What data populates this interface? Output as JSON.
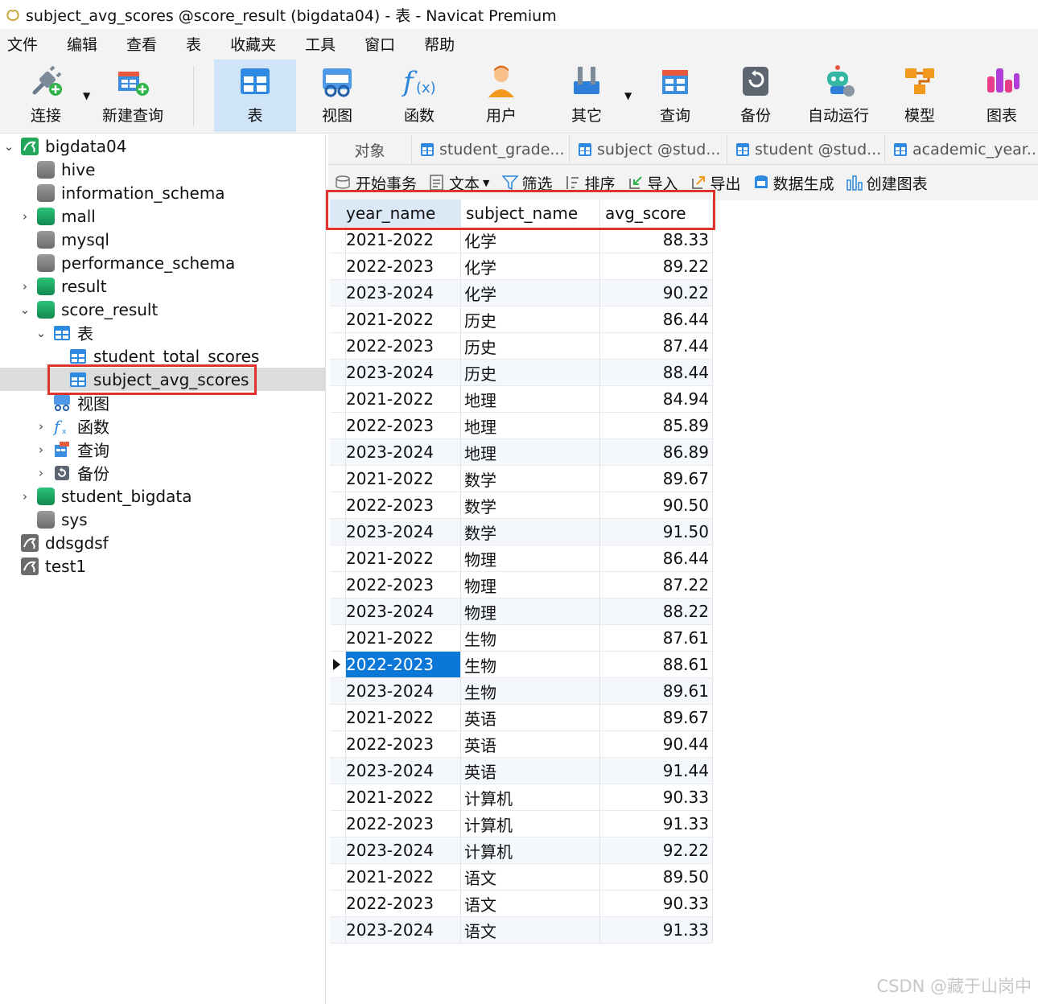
{
  "window": {
    "title": "subject_avg_scores @score_result (bigdata04) - 表 - Navicat Premium"
  },
  "menu": [
    "文件",
    "编辑",
    "查看",
    "表",
    "收藏夹",
    "工具",
    "窗口",
    "帮助"
  ],
  "toolbar": [
    {
      "label": "连接",
      "icon": "connection-plug-icon"
    },
    {
      "label": "新建查询",
      "icon": "new-query-icon"
    },
    {
      "label": "表",
      "icon": "table-icon",
      "active": true
    },
    {
      "label": "视图",
      "icon": "view-icon"
    },
    {
      "label": "函数",
      "icon": "function-icon"
    },
    {
      "label": "用户",
      "icon": "user-icon"
    },
    {
      "label": "其它",
      "icon": "tools-icon"
    },
    {
      "label": "查询",
      "icon": "query-icon"
    },
    {
      "label": "备份",
      "icon": "backup-icon"
    },
    {
      "label": "自动运行",
      "icon": "robot-icon"
    },
    {
      "label": "模型",
      "icon": "model-icon"
    },
    {
      "label": "图表",
      "icon": "chart-icon"
    }
  ],
  "tree": [
    {
      "label": "bigdata04"
    },
    {
      "label": "hive"
    },
    {
      "label": "information_schema"
    },
    {
      "label": "mall"
    },
    {
      "label": "mysql"
    },
    {
      "label": "performance_schema"
    },
    {
      "label": "result"
    },
    {
      "label": "score_result"
    },
    {
      "label": "表"
    },
    {
      "label": "student_total_scores"
    },
    {
      "label": "subject_avg_scores"
    },
    {
      "label": "视图"
    },
    {
      "label": "函数"
    },
    {
      "label": "查询"
    },
    {
      "label": "备份"
    },
    {
      "label": "student_bigdata"
    },
    {
      "label": "sys"
    },
    {
      "label": "ddsgdsf"
    },
    {
      "label": "test1"
    }
  ],
  "tabs": [
    "对象",
    "student_grade...",
    "subject @stud...",
    "student @stud...",
    "academic_year..."
  ],
  "actions": [
    "开始事务",
    "文本",
    "筛选",
    "排序",
    "导入",
    "导出",
    "数据生成",
    "创建图表"
  ],
  "columns": [
    "year_name",
    "subject_name",
    "avg_score"
  ],
  "rows": [
    [
      "2021-2022",
      "化学",
      "88.33"
    ],
    [
      "2022-2023",
      "化学",
      "89.22"
    ],
    [
      "2023-2024",
      "化学",
      "90.22"
    ],
    [
      "2021-2022",
      "历史",
      "86.44"
    ],
    [
      "2022-2023",
      "历史",
      "87.44"
    ],
    [
      "2023-2024",
      "历史",
      "88.44"
    ],
    [
      "2021-2022",
      "地理",
      "84.94"
    ],
    [
      "2022-2023",
      "地理",
      "85.89"
    ],
    [
      "2023-2024",
      "地理",
      "86.89"
    ],
    [
      "2021-2022",
      "数学",
      "89.67"
    ],
    [
      "2022-2023",
      "数学",
      "90.50"
    ],
    [
      "2023-2024",
      "数学",
      "91.50"
    ],
    [
      "2021-2022",
      "物理",
      "86.44"
    ],
    [
      "2022-2023",
      "物理",
      "87.22"
    ],
    [
      "2023-2024",
      "物理",
      "88.22"
    ],
    [
      "2021-2022",
      "生物",
      "87.61"
    ],
    [
      "2022-2023",
      "生物",
      "88.61"
    ],
    [
      "2023-2024",
      "生物",
      "89.61"
    ],
    [
      "2021-2022",
      "英语",
      "89.67"
    ],
    [
      "2022-2023",
      "英语",
      "90.44"
    ],
    [
      "2023-2024",
      "英语",
      "91.44"
    ],
    [
      "2021-2022",
      "计算机",
      "90.33"
    ],
    [
      "2022-2023",
      "计算机",
      "91.33"
    ],
    [
      "2023-2024",
      "计算机",
      "92.22"
    ],
    [
      "2021-2022",
      "语文",
      "89.50"
    ],
    [
      "2022-2023",
      "语文",
      "90.33"
    ],
    [
      "2023-2024",
      "语文",
      "91.33"
    ]
  ],
  "watermark": "CSDN @藏于山岗中",
  "colors": {
    "selection": "#0b78d7",
    "highlight": "#e0332e",
    "active_tab": "#cfe4f7"
  }
}
